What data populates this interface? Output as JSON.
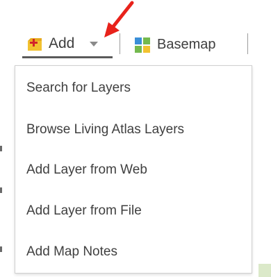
{
  "toolbar": {
    "add_label": "Add",
    "add_icon": "add-layer-icon",
    "caret_icon": "caret-down-icon",
    "basemap_label": "Basemap",
    "basemap_icon": "basemap-grid-icon"
  },
  "add_menu": {
    "items": [
      "Search for Layers",
      "Browse Living Atlas Layers",
      "Add Layer from Web",
      "Add Layer from File",
      "Add Map Notes"
    ]
  },
  "annotation": {
    "arrow_icon": "red-arrow-icon",
    "arrow_color": "#e8221b"
  },
  "colors": {
    "add_icon_fill": "#f2c230",
    "add_plus": "#d2232a",
    "basemap_blue": "#3a8fd8",
    "basemap_green": "#74b94e",
    "basemap_yellow": "#f2c230",
    "text": "#3e3e3e"
  }
}
